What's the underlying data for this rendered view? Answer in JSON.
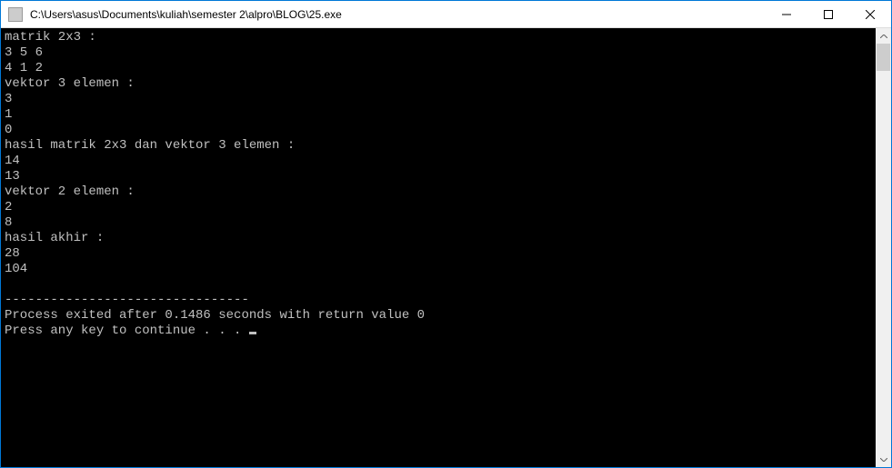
{
  "window": {
    "title": "C:\\Users\\asus\\Documents\\kuliah\\semester 2\\alpro\\BLOG\\25.exe"
  },
  "console": {
    "lines": [
      "matrik 2x3 :",
      "3 5 6",
      "4 1 2",
      "vektor 3 elemen :",
      "3",
      "1",
      "0",
      "hasil matrik 2x3 dan vektor 3 elemen :",
      "14",
      "13",
      "vektor 2 elemen :",
      "2",
      "8",
      "hasil akhir :",
      "28",
      "104",
      "",
      "--------------------------------",
      "Process exited after 0.1486 seconds with return value 0",
      "Press any key to continue . . . "
    ]
  }
}
